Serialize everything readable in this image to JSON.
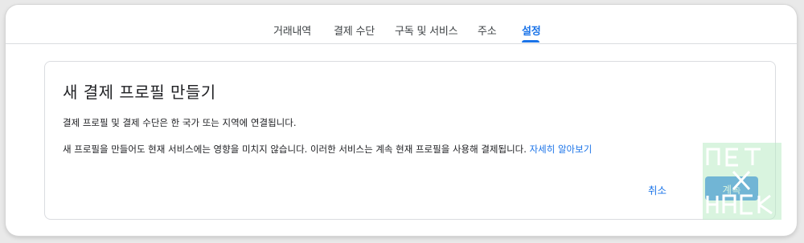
{
  "tabs": [
    {
      "label": "거래내역"
    },
    {
      "label": "결제 수단"
    },
    {
      "label": "구독 및 서비스"
    },
    {
      "label": "주소"
    },
    {
      "label": "설정",
      "active": true
    }
  ],
  "dialog": {
    "title": "새 결제 프로필 만들기",
    "line1": "결제 프로필 및 결제 수단은 한 국가 또는 지역에 연결됩니다.",
    "line2": "새 프로필을 만들어도 현재 서비스에는 영향을 미치지 않습니다. 이러한 서비스는 계속 현재 프로필을 사용해 결제됩니다.",
    "learn_more": "자세히 알아보기",
    "cancel_label": "취소",
    "continue_label": "계속"
  },
  "watermark": {
    "text": "NETXHACK",
    "color": "#7fcf8f"
  },
  "colors": {
    "accent": "#1a73e8",
    "text": "#202124",
    "border": "#dadce0"
  }
}
